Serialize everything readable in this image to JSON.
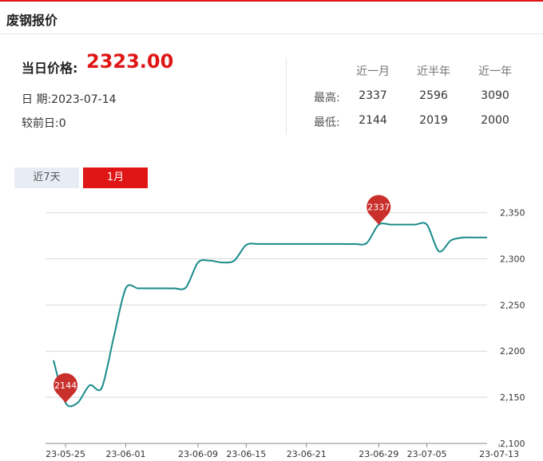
{
  "header": {
    "title": "废钢报价"
  },
  "price": {
    "label": "当日价格:",
    "value": "2323.00"
  },
  "info": {
    "date": "日 期:2023-07-14",
    "diff": "较前日:0"
  },
  "stats": {
    "columns": [
      "近一月",
      "近半年",
      "近一年"
    ],
    "rows": [
      {
        "label": "最高:",
        "values": [
          "2337",
          "2596",
          "3090"
        ]
      },
      {
        "label": "最低:",
        "values": [
          "2144",
          "2019",
          "2000"
        ]
      }
    ]
  },
  "tabs": [
    {
      "label": "近7天"
    },
    {
      "label": "1月"
    }
  ],
  "chart_data": {
    "type": "line",
    "ylim": [
      2100,
      2360
    ],
    "yticks": [
      2100,
      2150,
      2200,
      2250,
      2300,
      2350
    ],
    "ytick_labels": [
      "2,100",
      "2,150",
      "2,200",
      "2,250",
      "2,300",
      "2,350"
    ],
    "xtick_labels": [
      "23-05-25",
      "23-06-01",
      "23-06-09",
      "23-06-15",
      "23-06-21",
      "23-06-29",
      "23-07-05",
      "23-07-13"
    ],
    "xtick_index": [
      1,
      6,
      12,
      16,
      21,
      27,
      31,
      37
    ],
    "x": [
      "23-05-24",
      "23-05-25",
      "23-05-26",
      "23-05-29",
      "23-05-30",
      "23-05-31",
      "23-06-01",
      "23-06-02",
      "23-06-05",
      "23-06-06",
      "23-06-07",
      "23-06-08",
      "23-06-09",
      "23-06-12",
      "23-06-13",
      "23-06-14",
      "23-06-15",
      "23-06-16",
      "23-06-19",
      "23-06-20",
      "23-06-21",
      "23-06-22",
      "23-06-26",
      "23-06-27",
      "23-06-28",
      "23-06-29",
      "23-06-30",
      "23-07-03",
      "23-07-04",
      "23-07-05",
      "23-07-06",
      "23-07-07",
      "23-07-10",
      "23-07-11",
      "23-07-12",
      "23-07-13",
      "23-07-14"
    ],
    "series": [
      {
        "values": [
          2190,
          2144,
          2144,
          2163,
          2160,
          2215,
          2268,
          2268,
          2268,
          2268,
          2268,
          2269,
          2296,
          2298,
          2296,
          2298,
          2315,
          2316,
          2316,
          2316,
          2316,
          2316,
          2316,
          2316,
          2316,
          2316,
          2317,
          2337,
          2337,
          2337,
          2337,
          2337,
          2308,
          2320,
          2323,
          2323,
          2323
        ],
        "color": "#1a8a8a"
      }
    ],
    "markers": [
      {
        "label": "2144",
        "index": 1
      },
      {
        "label": "2337",
        "index": 27
      }
    ],
    "marker_color": "#c9302c",
    "grid": true
  }
}
